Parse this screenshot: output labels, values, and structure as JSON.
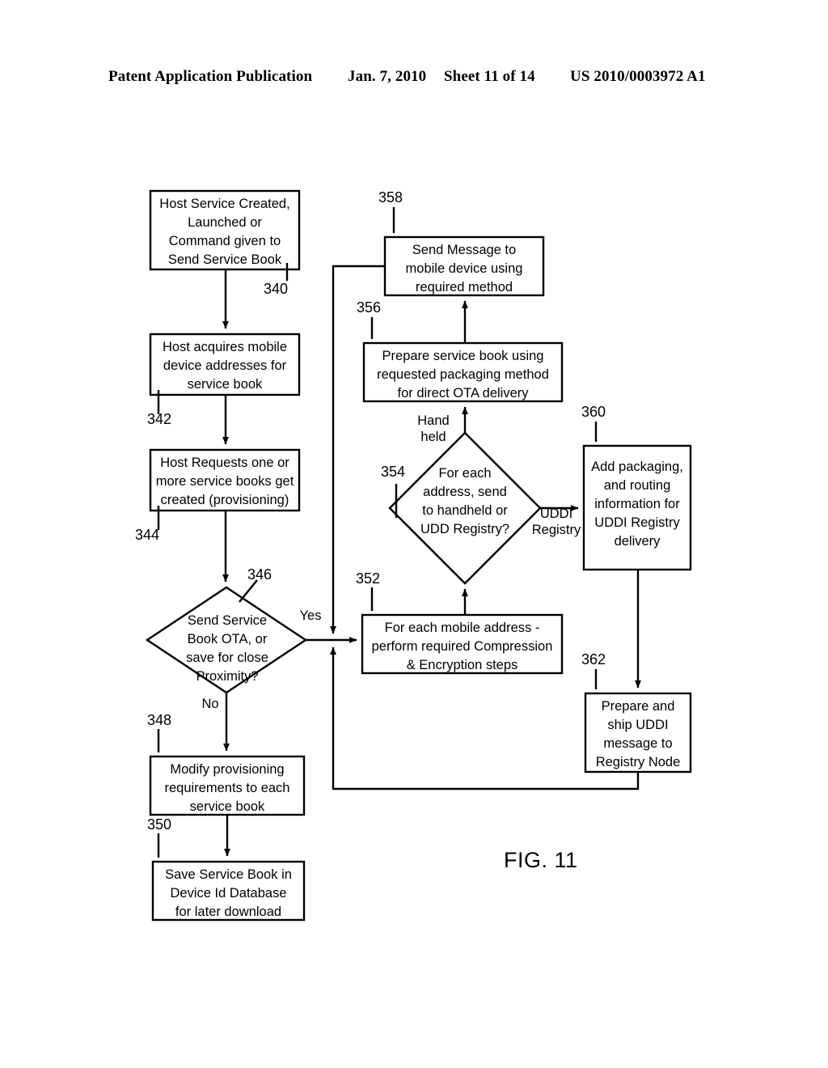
{
  "header": {
    "publication": "Patent Application Publication",
    "date": "Jan. 7, 2010",
    "sheet": "Sheet 11 of 14",
    "patent_number": "US 2010/0003972 A1"
  },
  "figure": {
    "caption": "FIG. 11",
    "nodes": [
      {
        "id": "n340",
        "ref": "340",
        "shape": "box",
        "text": "Host Service Created,\nLaunched or\nCommand given to\nSend Service Book"
      },
      {
        "id": "n342",
        "ref": "342",
        "shape": "box",
        "text": "Host acquires mobile\ndevice addresses for\nservice book"
      },
      {
        "id": "n344",
        "ref": "344",
        "shape": "box",
        "text": "Host Requests one or\nmore service books get\ncreated (provisioning)"
      },
      {
        "id": "n346",
        "ref": "346",
        "shape": "diamond",
        "text": "Send Service\nBook OTA, or\nsave for close\nProximity?"
      },
      {
        "id": "n348",
        "ref": "348",
        "shape": "box",
        "text": "Modify provisioning\nrequirements to each\nservice book"
      },
      {
        "id": "n350",
        "ref": "350",
        "shape": "box",
        "text": "Save Service Book in\nDevice Id Database\nfor later download"
      },
      {
        "id": "n352",
        "ref": "352",
        "shape": "box",
        "text": "For each mobile address -\nperform required Compression\n& Encryption steps"
      },
      {
        "id": "n354",
        "ref": "354",
        "shape": "diamond",
        "text": "For each\naddress, send\nto handheld or\nUDD Registry?"
      },
      {
        "id": "n356",
        "ref": "356",
        "shape": "box",
        "text": "Prepare service book using\nrequested packaging method\nfor direct OTA delivery"
      },
      {
        "id": "n358",
        "ref": "358",
        "shape": "box",
        "text": "Send Message to\nmobile device using\nrequired method"
      },
      {
        "id": "n360",
        "ref": "360",
        "shape": "box",
        "text": "Add packaging,\nand routing\ninformation for\nUDDI Registry\ndelivery"
      },
      {
        "id": "n362",
        "ref": "362",
        "shape": "box",
        "text": "Prepare and\nship UDDI\nmessage to\nRegistry Node"
      }
    ],
    "edge_labels": [
      {
        "id": "e-yes",
        "text": "Yes"
      },
      {
        "id": "e-no",
        "text": "No"
      },
      {
        "id": "e-handheld",
        "text": "Hand\nheld"
      },
      {
        "id": "e-uddi",
        "text": "UDDI\nRegistry"
      }
    ]
  }
}
